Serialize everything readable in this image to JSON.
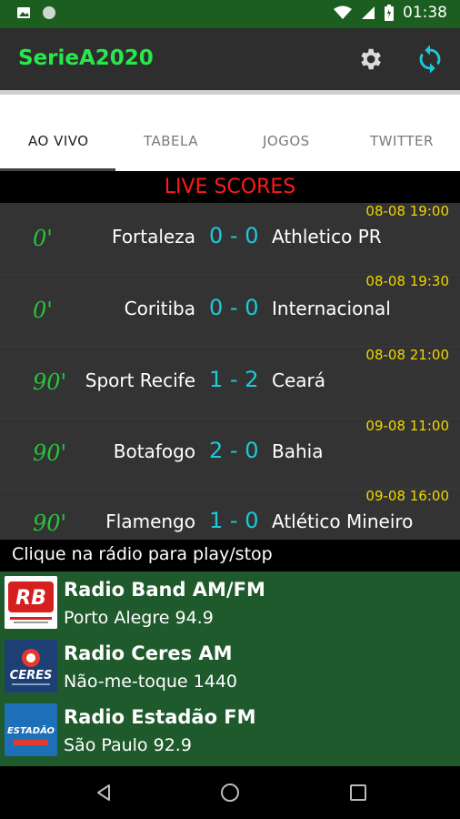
{
  "status_bar": {
    "time": "01:38"
  },
  "app": {
    "title": "SerieA2020"
  },
  "tabs": [
    {
      "label": "AO VIVO",
      "active": true
    },
    {
      "label": "TABELA"
    },
    {
      "label": "JOGOS"
    },
    {
      "label": "TWITTER"
    }
  ],
  "live_header": "LIVE SCORES",
  "matches": [
    {
      "datetime": "08-08 19:00",
      "minute": "0'",
      "home": "Fortaleza",
      "score": "0 - 0",
      "away": "Athletico PR"
    },
    {
      "datetime": "08-08 19:30",
      "minute": "0'",
      "home": "Coritiba",
      "score": "0 - 0",
      "away": "Internacional"
    },
    {
      "datetime": "08-08 21:00",
      "minute": "90'",
      "home": "Sport Recife",
      "score": "1 - 2",
      "away": "Ceará"
    },
    {
      "datetime": "09-08 11:00",
      "minute": "90'",
      "home": "Botafogo",
      "score": "2 - 0",
      "away": "Bahia"
    },
    {
      "datetime": "09-08 16:00",
      "minute": "90'",
      "home": "Flamengo",
      "score": "1 - 0",
      "away": "Atlético Mineiro"
    }
  ],
  "radio_header": "Clique na rádio para play/stop",
  "radios": [
    {
      "name": "Radio Band AM/FM",
      "city": "Porto Alegre 94.9",
      "logo_text": "RB"
    },
    {
      "name": "Radio Ceres AM",
      "city": "Não-me-toque 1440",
      "logo_text": "CERES"
    },
    {
      "name": "Radio Estadão FM",
      "city": "São Paulo 92.9",
      "logo_text": "ESTADÃO"
    }
  ],
  "colors": {
    "accent_green": "#27e84a",
    "sync_cyan": "#1ec8d8",
    "live_red": "#ff1a1a",
    "date_yellow": "#f2d600",
    "radio_bg": "#1f5a2c"
  }
}
